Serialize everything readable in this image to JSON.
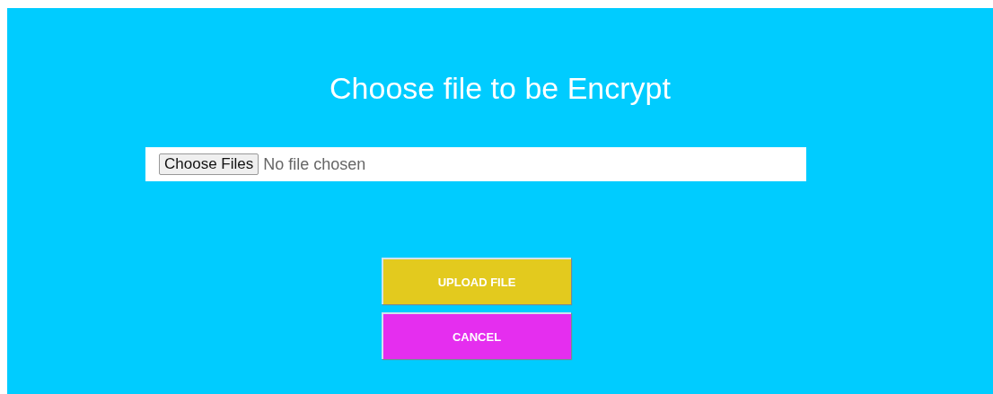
{
  "title": "Choose file to be Encrypt",
  "file_input": {
    "button": "Choose Files",
    "status": "No file chosen"
  },
  "buttons": [
    {
      "label": "UPLOAD FILE",
      "color": "#e3ca1e"
    },
    {
      "label": "CANCEL",
      "color": "#e52eef"
    }
  ]
}
